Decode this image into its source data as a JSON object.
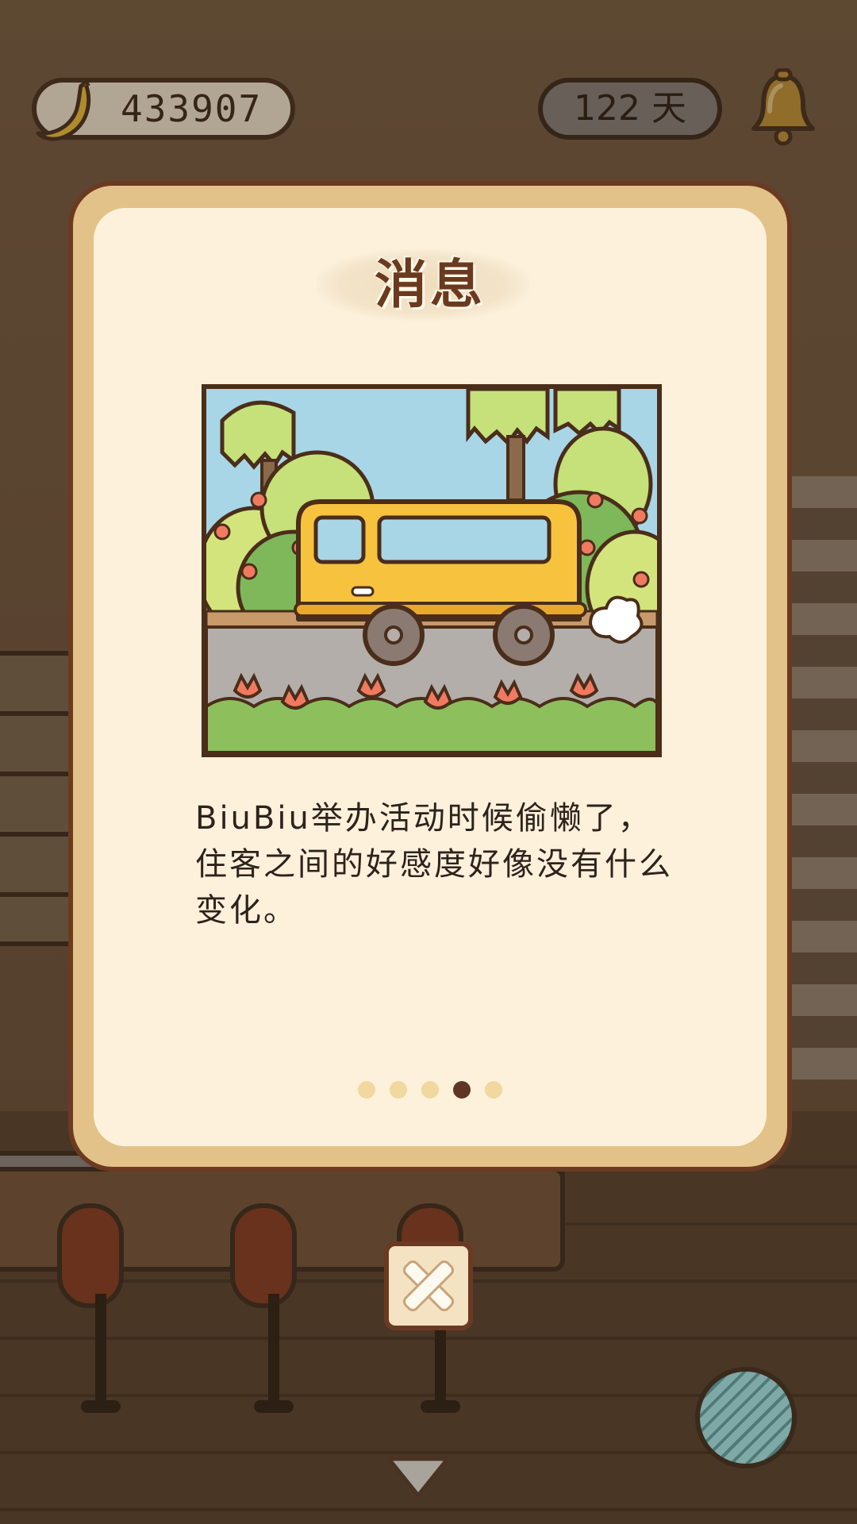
{
  "hud": {
    "banana_count": "433907",
    "days_label": "122 天"
  },
  "modal": {
    "title": "消息",
    "message": "BiuBiu举办活动时候偷懒了，住客之间的好感度好像没有什么变化。",
    "pager": {
      "total_pages": 5,
      "current_page": 4
    }
  },
  "colors": {
    "modal_border": "#6b3a22",
    "modal_frame": "#e3c289",
    "modal_background": "#fdf1dc",
    "title_text": "#6b3a1e",
    "pager_dot": "#f0d89e",
    "pager_dot_active": "#5e3623",
    "van": "#f7c23e",
    "sky": "#a8d6e6"
  },
  "icons": {
    "banana": "banana-icon",
    "bell": "bell-icon",
    "close": "close-icon",
    "collapse": "chevron-down-icon",
    "yarn": "yarn-ball-icon"
  }
}
